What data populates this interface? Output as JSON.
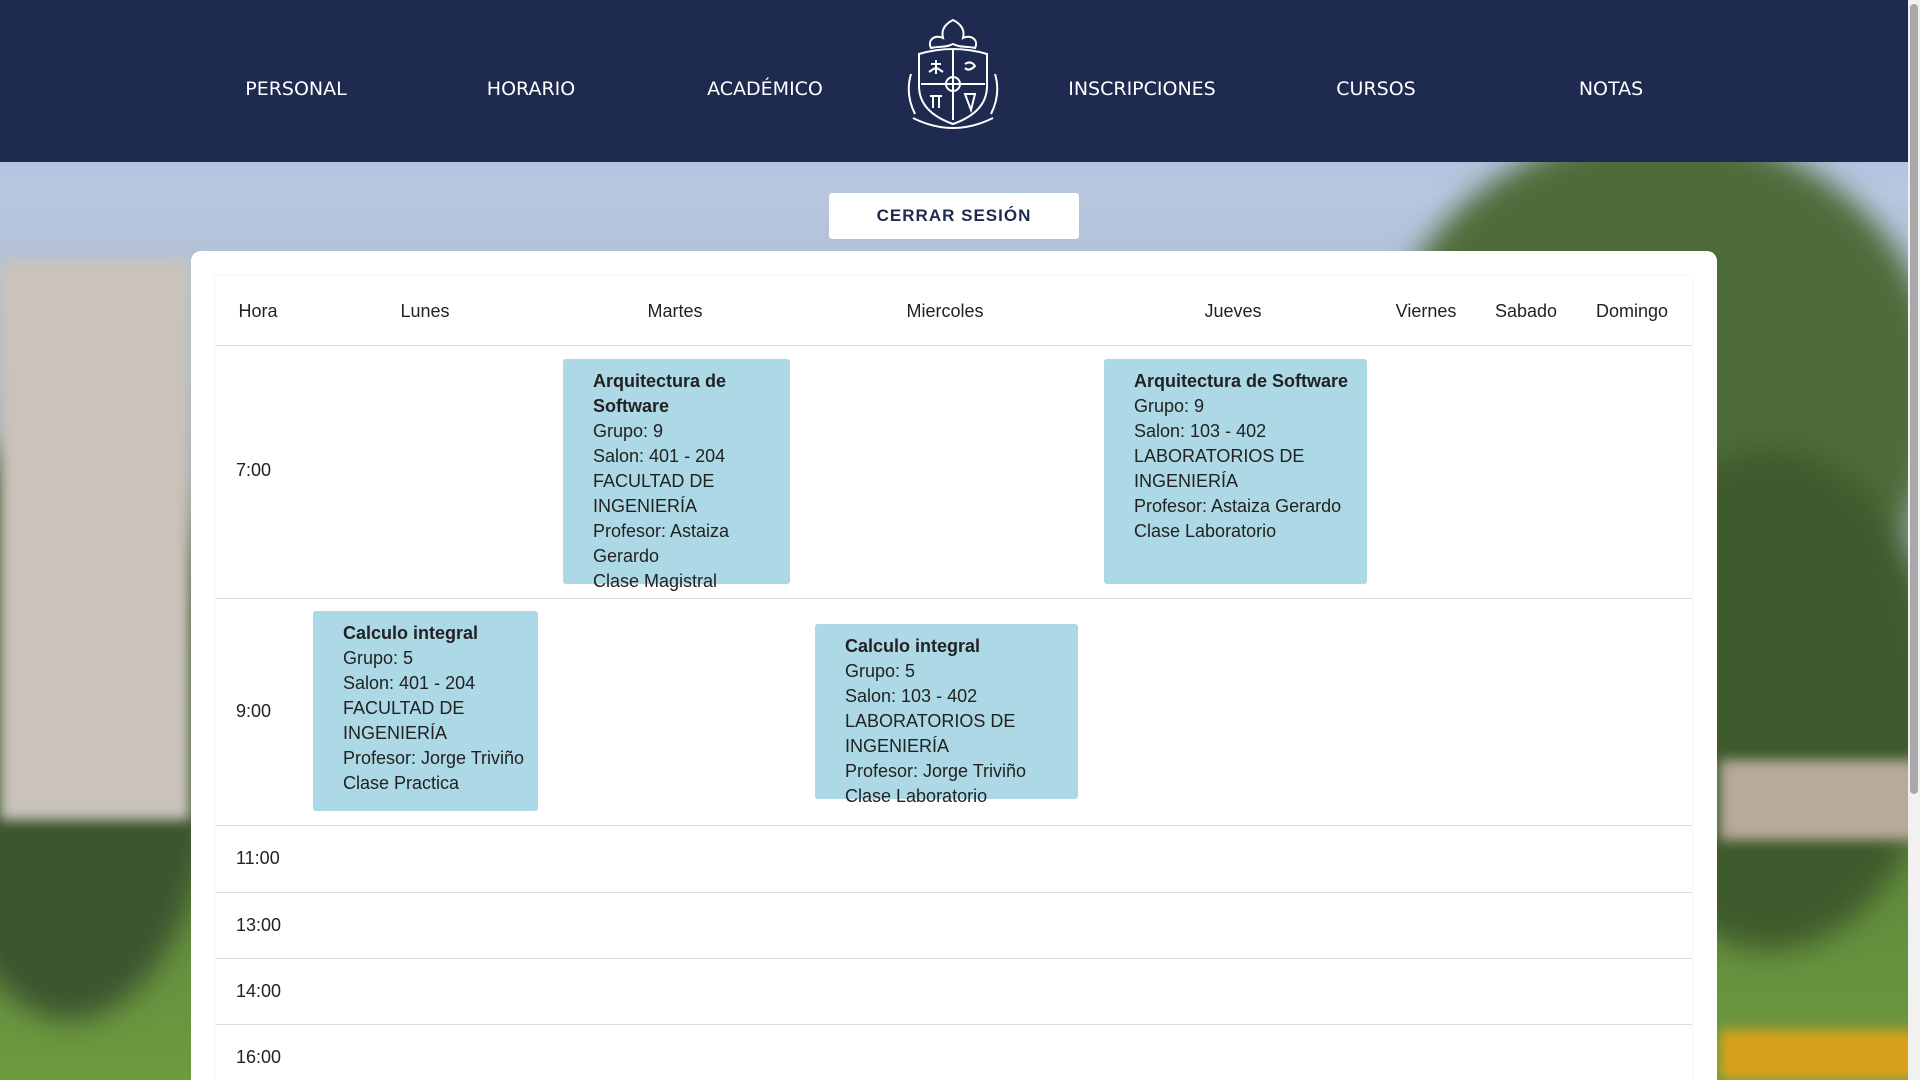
{
  "nav": {
    "items": [
      "PERSONAL",
      "HORARIO",
      "ACADÉMICO",
      "INSCRIPCIONES",
      "CURSOS",
      "NOTAS"
    ]
  },
  "logout_label": "CERRAR SESIÓN",
  "schedule": {
    "headers": [
      "Hora",
      "Lunes",
      "Martes",
      "Miercoles",
      "Jueves",
      "Viernes",
      "Sabado",
      "Domingo"
    ],
    "hours": [
      "7:00",
      "9:00",
      "11:00",
      "13:00",
      "14:00",
      "16:00"
    ],
    "classes": [
      {
        "title": "Arquitectura de Software",
        "group": "Grupo: 9",
        "room": "Salon: 401 - 204",
        "building": "FACULTAD DE INGENIERÍA",
        "teacher": "Profesor: Astaiza Gerardo",
        "type": "Clase Magistral"
      },
      {
        "title": "Arquitectura de Software",
        "group": "Grupo: 9",
        "room": "Salon: 103 - 402",
        "building": "LABORATORIOS DE INGENIERÍA",
        "teacher": "Profesor: Astaiza Gerardo",
        "type": "Clase Laboratorio"
      },
      {
        "title": "Calculo integral",
        "group": "Grupo: 5",
        "room": "Salon: 401 - 204",
        "building": "FACULTAD DE INGENIERÍA",
        "teacher": "Profesor: Jorge Triviño",
        "type": "Clase Practica"
      },
      {
        "title": "Calculo integral",
        "group": "Grupo: 5",
        "room": "Salon: 103 - 402",
        "building": "LABORATORIOS DE INGENIERÍA",
        "teacher": "Profesor: Jorge Triviño",
        "type": "Clase Laboratorio"
      }
    ]
  },
  "colors": {
    "header_bg": "#1e2a4f",
    "class_block": "#add8e6"
  }
}
